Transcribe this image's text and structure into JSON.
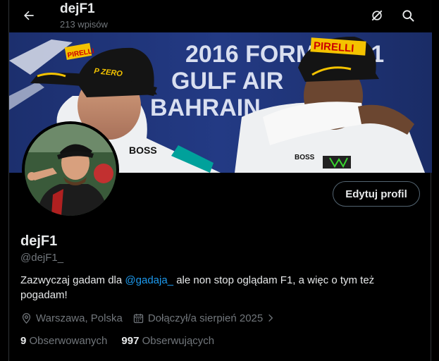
{
  "header": {
    "title": "dejF1",
    "post_count": "213 wpisów",
    "icons": {
      "back": "back-arrow-icon",
      "grok": "grok-icon",
      "search": "search-icon"
    }
  },
  "banner": {
    "backdrop_text_1": "2016 FORMULA 1",
    "backdrop_text_2": "GULF AIR",
    "backdrop_text_3": "BAHRAIN",
    "cap_brand": "PIRELLI",
    "cap_sub": "P ZERO",
    "suit_brand": "BOSS"
  },
  "profile": {
    "edit_label": "Edytuj profil",
    "display_name": "dejF1",
    "handle": "@dejF1_",
    "bio_before": "Zazwyczaj gadam dla ",
    "bio_mention": "@gadaja_",
    "bio_after": " ale non stop oglądam F1, a więc o tym też pogadam!",
    "location": "Warszawa, Polska",
    "joined": "Dołączył/a sierpień 2025",
    "following_count": "9",
    "following_label": "Obserwowanych",
    "followers_count": "997",
    "followers_label": "Obserwujących"
  },
  "colors": {
    "background": "#000000",
    "text": "#e7e9ea",
    "muted": "#71767b",
    "accent": "#1d9bf0",
    "border": "#536471"
  }
}
